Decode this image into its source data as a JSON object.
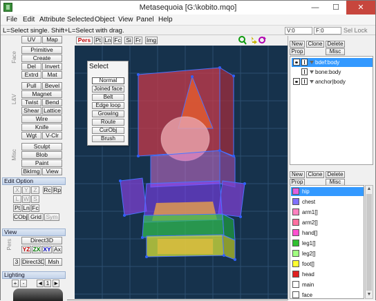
{
  "window": {
    "title": "Metasequoia [G:\\kobito.mqo]",
    "minimize": "—",
    "maximize": "☐",
    "close": "✕"
  },
  "menu": [
    "File",
    "Edit",
    "Attribute",
    "Selected",
    "Object",
    "View",
    "Panel",
    "Help"
  ],
  "status": {
    "hint": "L=Select single.  Shift+L=Select with drag.",
    "v": "V:0",
    "f": "F:0",
    "sel_lock": "Sel Lock"
  },
  "left": {
    "top": [
      "UV",
      "Map"
    ],
    "face_label": "Face",
    "face": [
      "Primitive",
      "Create",
      "Del",
      "Invert",
      "Extrd",
      "Mat"
    ],
    "lsv_label": "L&V",
    "lsv": [
      "Pull",
      "Bevel",
      "Magnet",
      "Twist",
      "Bend",
      "Shear",
      "Lattice",
      "Wire",
      "Knife",
      "Wgt",
      "V-Clr"
    ],
    "misc_label": "Misc",
    "misc": [
      "Sculpt",
      "Blob",
      "Paint",
      "BkImg",
      "View"
    ],
    "edit_option": "Edit Option",
    "axis": [
      "X",
      "Y",
      "Z",
      "Rc",
      "Rp",
      "L",
      "W",
      "S",
      "Pt",
      "Ln",
      "Fc",
      "CObj",
      "Grid",
      "Sym"
    ],
    "view_head": "View",
    "pers_label": "Pers",
    "view_btns": [
      "Direct3D",
      "YZ",
      "ZX",
      "XY",
      "Ax",
      "3",
      "Direct3D",
      "Msh"
    ],
    "lighting": "Lighting",
    "light_btns": [
      "+",
      "-",
      "◄",
      "1",
      "►"
    ]
  },
  "viewport": {
    "tabs": [
      "Pers",
      "Pt",
      "Ln",
      "Fc",
      "Si",
      "Fr",
      "Img"
    ],
    "icons": [
      "zoom-icon",
      "move-icon",
      "rotate-icon"
    ]
  },
  "select_popup": {
    "title": "Select",
    "buttons": [
      "Normal",
      "Joined face",
      "Belt",
      "Edge loop",
      "Growing",
      "Route",
      "CurObj",
      "Brush"
    ],
    "active": "Normal"
  },
  "objects": {
    "buttons": [
      "New",
      "Clone",
      "Delete",
      "Prop",
      "Misc"
    ],
    "items": [
      {
        "name": "bdef:body",
        "selected": true
      },
      {
        "name": "bone:body",
        "selected": false
      },
      {
        "name": "anchor|body",
        "selected": false
      }
    ]
  },
  "materials": {
    "buttons": [
      "New",
      "Clone",
      "Delete",
      "Prop",
      "Misc"
    ],
    "items": [
      {
        "name": "hip",
        "color": "#e060e0",
        "selected": true
      },
      {
        "name": "chest",
        "color": "#8070ff",
        "selected": false
      },
      {
        "name": "arm1[]",
        "color": "#ff80c0",
        "selected": false
      },
      {
        "name": "arm2[]",
        "color": "#ff70a0",
        "selected": false
      },
      {
        "name": "hand[]",
        "color": "#ff50d0",
        "selected": false
      },
      {
        "name": "leg1[]",
        "color": "#30c030",
        "selected": false
      },
      {
        "name": "leg2[]",
        "color": "#a0ff80",
        "selected": false
      },
      {
        "name": "foot[]",
        "color": "#ffff30",
        "selected": false
      },
      {
        "name": "head",
        "color": "#e02020",
        "selected": false
      },
      {
        "name": "main",
        "color": "#ffffff",
        "selected": false
      },
      {
        "name": "face",
        "color": "#ffffff",
        "selected": false
      }
    ]
  }
}
